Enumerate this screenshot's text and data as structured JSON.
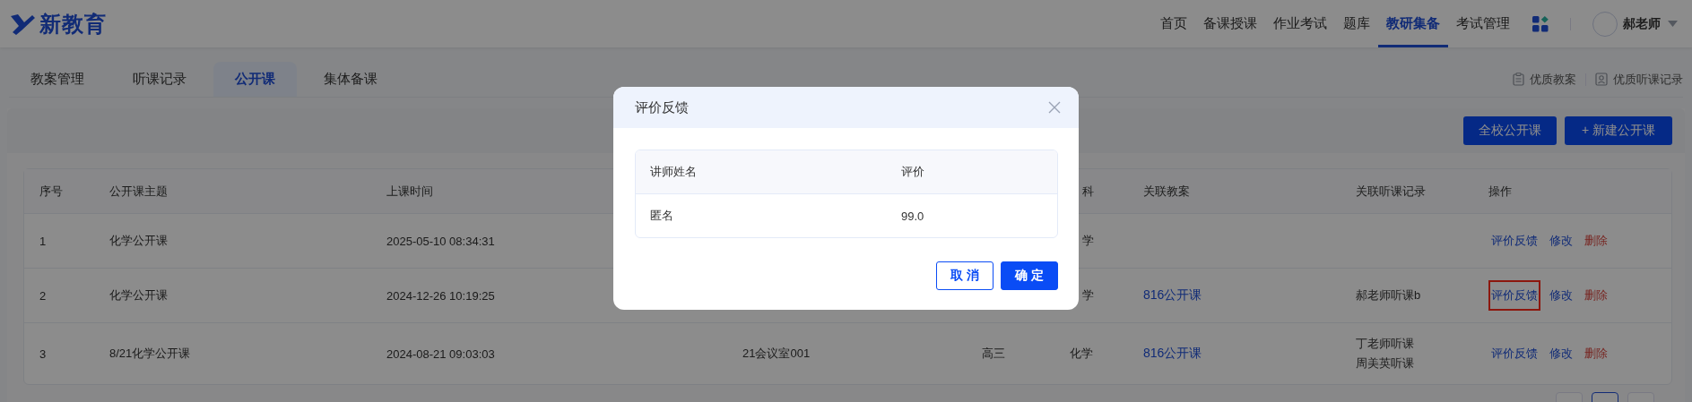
{
  "header": {
    "logo_text": "新教育",
    "nav": [
      {
        "label": "首页",
        "selected": false
      },
      {
        "label": "备课授课",
        "selected": false
      },
      {
        "label": "作业考试",
        "selected": false
      },
      {
        "label": "题库",
        "selected": false
      },
      {
        "label": "教研集备",
        "selected": true
      },
      {
        "label": "考试管理",
        "selected": false
      }
    ],
    "user": "郝老师"
  },
  "tabs": [
    {
      "label": "教案管理",
      "selected": false
    },
    {
      "label": "听课记录",
      "selected": false
    },
    {
      "label": "公开课",
      "selected": true
    },
    {
      "label": "集体备课",
      "selected": false
    }
  ],
  "quick_links": [
    "优质教案",
    "优质听课记录"
  ],
  "toolbar_buttons": [
    {
      "label": "全校公开课",
      "kind": "plain"
    },
    {
      "label": "+ 新建公开课",
      "kind": "create"
    }
  ],
  "table": {
    "columns": [
      "序号",
      "公开课主题",
      "上课时间",
      "",
      "",
      "科",
      "关联教案",
      "关联听课记录",
      "操作"
    ],
    "rows": [
      {
        "cells": [
          "1",
          "化学公开课",
          "2025-05-10 08:34:31",
          "",
          "",
          {
            "text": "学",
            "clipped": true
          },
          "",
          []
        ],
        "actions": [
          {
            "label": "评价反馈",
            "kind": "feedback",
            "highlighted": false
          },
          {
            "label": "修改",
            "kind": "edit",
            "highlighted": false
          },
          {
            "label": "删除",
            "kind": "delete",
            "highlighted": false
          }
        ]
      },
      {
        "cells": [
          "2",
          "化学公开课",
          "2024-12-26 10:19:25",
          "",
          "",
          {
            "text": "学",
            "clipped": true
          },
          "816公开课",
          [
            "郝老师听课b"
          ]
        ],
        "actions": [
          {
            "label": "评价反馈",
            "kind": "feedback",
            "highlighted": true
          },
          {
            "label": "修改",
            "kind": "edit",
            "highlighted": false
          },
          {
            "label": "删除",
            "kind": "delete",
            "highlighted": false
          }
        ]
      },
      {
        "cells": [
          "3",
          "8/21化学公开课",
          "2024-08-21 09:03:03",
          "21会议室001",
          "高三",
          {
            "text": "化学",
            "clipped": false
          },
          "816公开课",
          [
            "丁老师听课",
            "周美英听课"
          ]
        ],
        "actions": [
          {
            "label": "评价反馈",
            "kind": "feedback",
            "highlighted": false
          },
          {
            "label": "修改",
            "kind": "edit",
            "highlighted": false
          },
          {
            "label": "删除",
            "kind": "delete",
            "highlighted": false
          }
        ]
      }
    ]
  },
  "pagination": [
    {
      "selected": false
    },
    {
      "selected": true
    },
    {
      "selected": false
    }
  ],
  "dialog": {
    "title": "评价反馈",
    "columns": [
      "讲师姓名",
      "评价"
    ],
    "rows": [
      [
        "匿名",
        "99.0"
      ]
    ],
    "buttons": [
      {
        "label": "取 消",
        "kind": "secondary"
      },
      {
        "label": "确 定",
        "kind": "primary"
      }
    ]
  }
}
